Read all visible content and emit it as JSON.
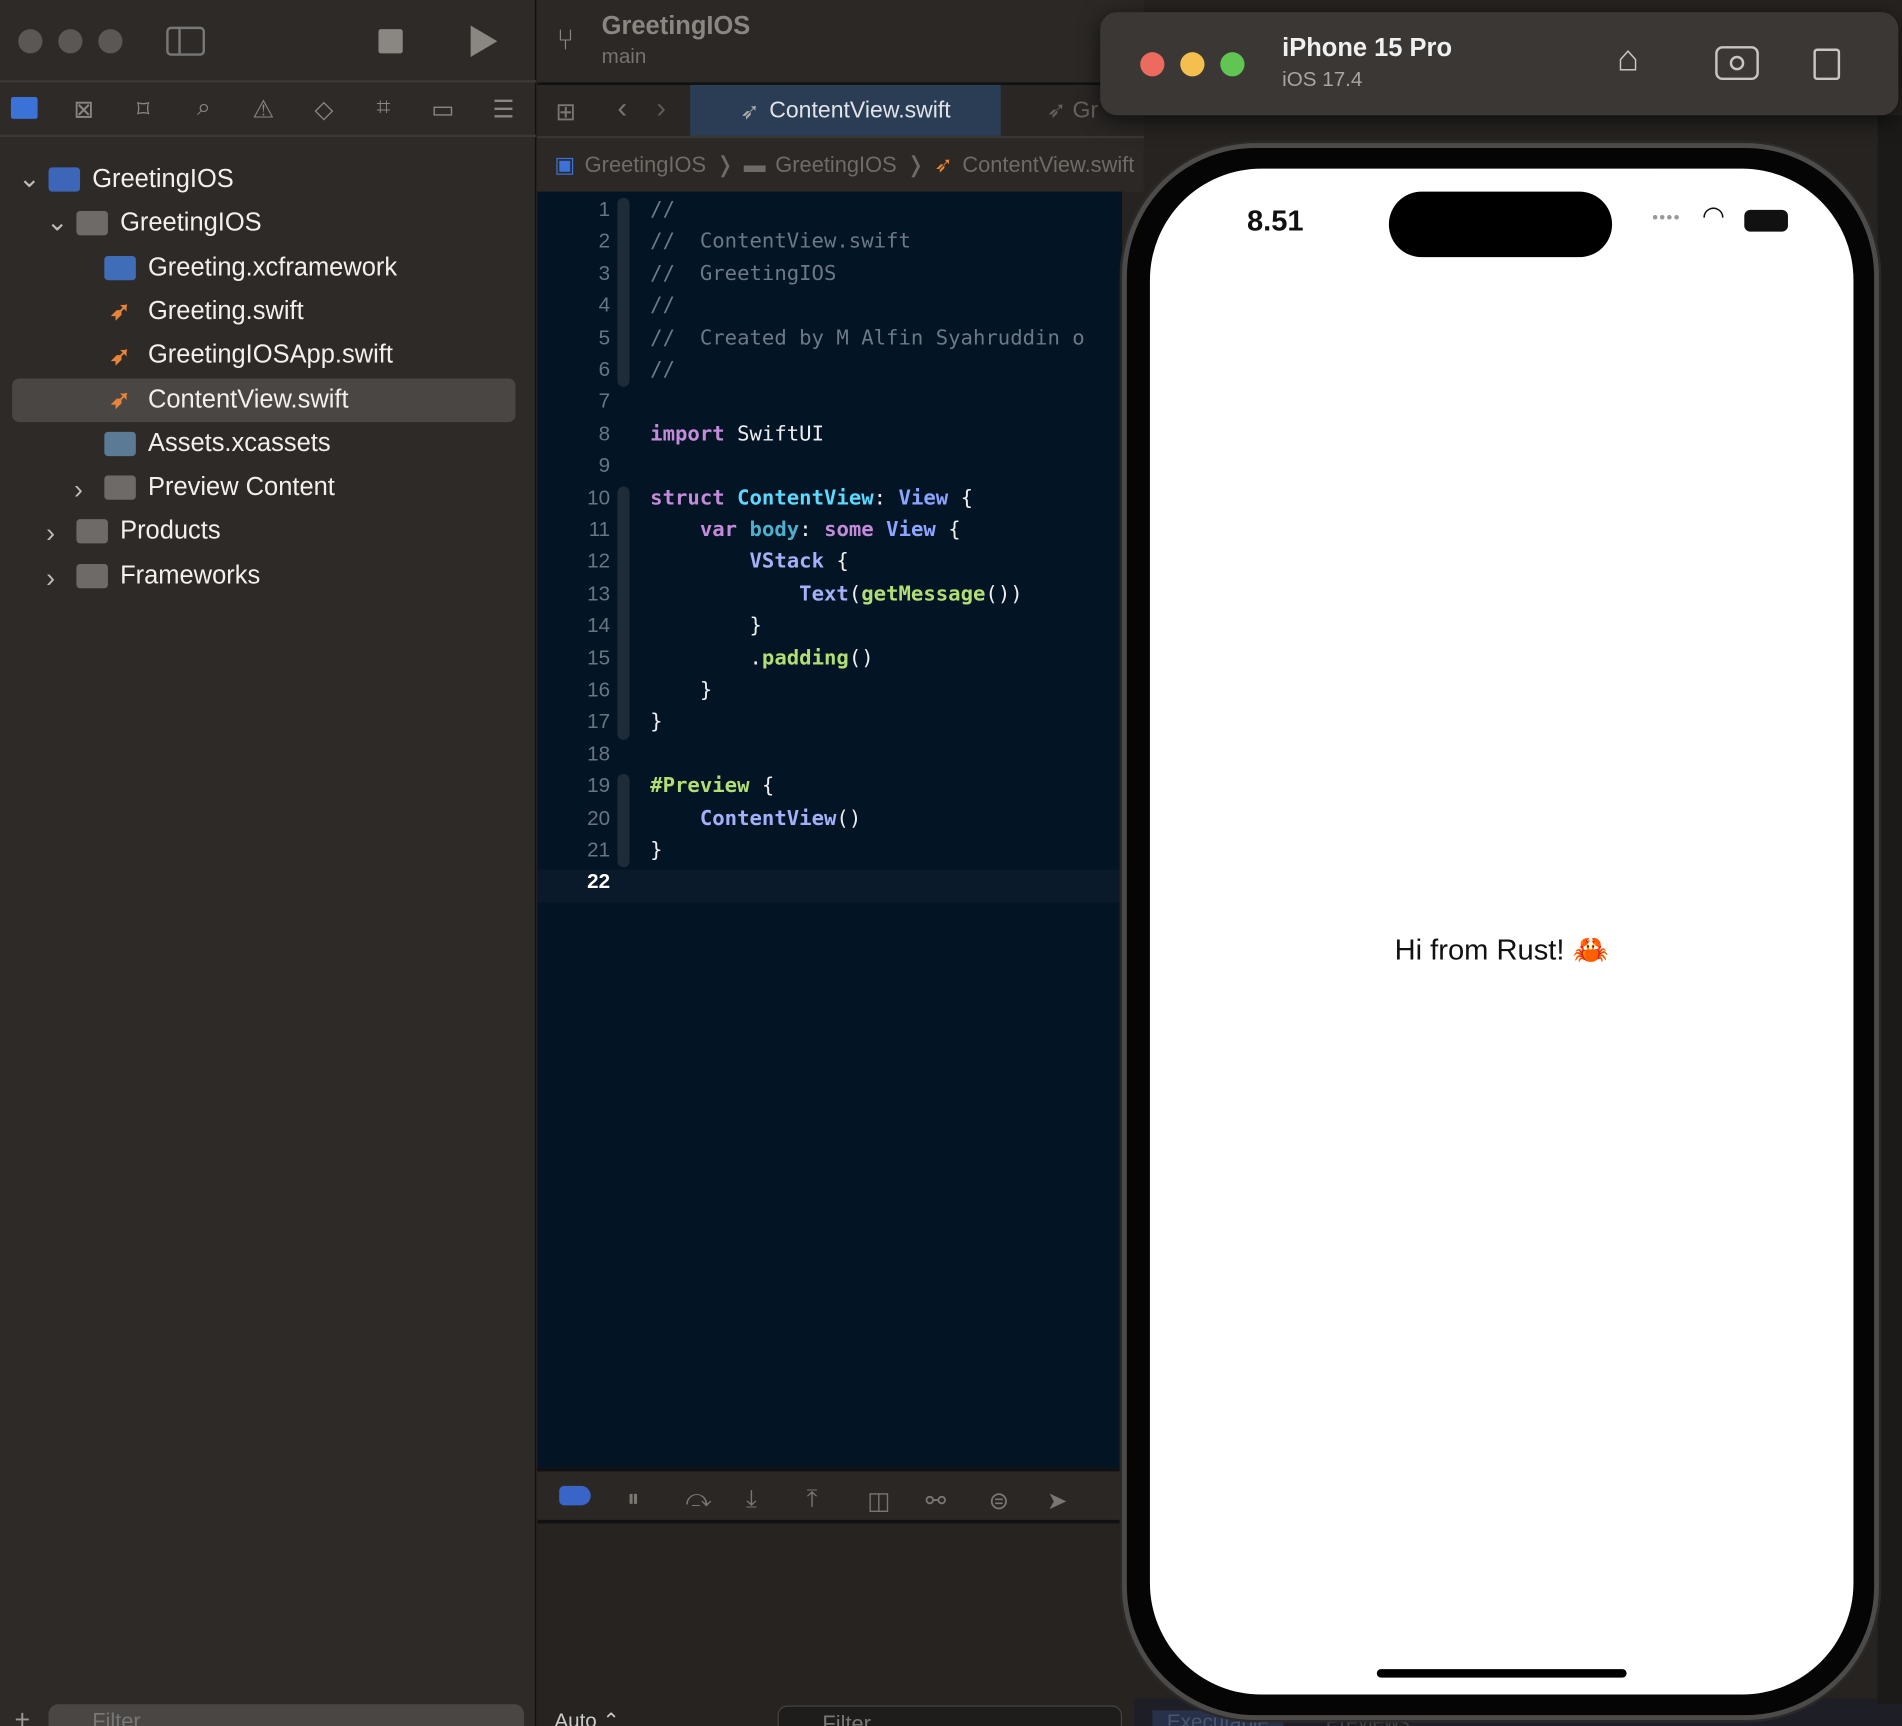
{
  "window": {
    "controls": [
      "close",
      "minimize",
      "zoom"
    ]
  },
  "toolbar": {
    "project": "GreetingIOS",
    "branch": "main",
    "stop_icon": "stop-icon",
    "run_icon": "play-icon"
  },
  "navigator_icons": [
    "folder-icon",
    "source-control-icon",
    "bookmark-icon",
    "search-icon",
    "warning-icon",
    "test-icon",
    "debug-icon",
    "breakpoint-icon",
    "report-icon"
  ],
  "tree": [
    {
      "label": "GreetingIOS",
      "type": "project",
      "level": 0,
      "expanded": true
    },
    {
      "label": "GreetingIOS",
      "type": "folder",
      "level": 1,
      "expanded": true
    },
    {
      "label": "Greeting.xcframework",
      "type": "framework",
      "level": 2
    },
    {
      "label": "Greeting.swift",
      "type": "swift",
      "level": 2
    },
    {
      "label": "GreetingIOSApp.swift",
      "type": "swift",
      "level": 2
    },
    {
      "label": "ContentView.swift",
      "type": "swift",
      "level": 2,
      "selected": true
    },
    {
      "label": "Assets.xcassets",
      "type": "assets",
      "level": 2
    },
    {
      "label": "Preview Content",
      "type": "folder",
      "level": 2,
      "expanded": false
    },
    {
      "label": "Products",
      "type": "folder",
      "level": 1,
      "expanded": false
    },
    {
      "label": "Frameworks",
      "type": "folder",
      "level": 1,
      "expanded": false
    }
  ],
  "tabs": [
    {
      "label": "ContentView.swift",
      "active": true
    },
    {
      "label": "Gr",
      "active": false
    }
  ],
  "breadcrumb": [
    "GreetingIOS",
    "GreetingIOS",
    "ContentView.swift"
  ],
  "code": {
    "current_line": 22,
    "lines": [
      [
        [
          "c",
          "//"
        ]
      ],
      [
        [
          "c",
          "//  ContentView.swift"
        ]
      ],
      [
        [
          "c",
          "//  GreetingIOS"
        ]
      ],
      [
        [
          "c",
          "//"
        ]
      ],
      [
        [
          "c",
          "//  Created by M Alfin Syahruddin o"
        ]
      ],
      [
        [
          "c",
          "//"
        ]
      ],
      [],
      [
        [
          "k",
          "import"
        ],
        [
          "p",
          " SwiftUI"
        ]
      ],
      [],
      [
        [
          "k",
          "struct"
        ],
        [
          "p",
          " "
        ],
        [
          "d",
          "ContentView"
        ],
        [
          "p",
          ": "
        ],
        [
          "t",
          "View"
        ],
        [
          "p",
          " {"
        ]
      ],
      [
        [
          "p",
          "    "
        ],
        [
          "k",
          "var"
        ],
        [
          "p",
          " "
        ],
        [
          "v",
          "body"
        ],
        [
          "p",
          ": "
        ],
        [
          "k",
          "some"
        ],
        [
          "p",
          " "
        ],
        [
          "t",
          "View"
        ],
        [
          "p",
          " {"
        ]
      ],
      [
        [
          "p",
          "        "
        ],
        [
          "f",
          "VStack"
        ],
        [
          "p",
          " {"
        ]
      ],
      [
        [
          "p",
          "            "
        ],
        [
          "f",
          "Text"
        ],
        [
          "p",
          "("
        ],
        [
          "g",
          "getMessage"
        ],
        [
          "p",
          "())"
        ]
      ],
      [
        [
          "p",
          "        }"
        ]
      ],
      [
        [
          "p",
          "        ."
        ],
        [
          "g",
          "padding"
        ],
        [
          "p",
          "()"
        ]
      ],
      [
        [
          "p",
          "    }"
        ]
      ],
      [
        [
          "p",
          "}"
        ]
      ],
      [],
      [
        [
          "g",
          "#Preview"
        ],
        [
          "p",
          " {"
        ]
      ],
      [
        [
          "p",
          "    "
        ],
        [
          "f",
          "ContentView"
        ],
        [
          "p",
          "()"
        ]
      ],
      [
        [
          "p",
          "}"
        ]
      ],
      []
    ]
  },
  "colors": {
    "c": "#6c7986",
    "k": "#c38bd9",
    "p": "#eceef0",
    "d": "#5dd8ff",
    "t": "#8ea5ff",
    "v": "#4eb0cc",
    "f": "#a3b1f9",
    "g": "#b2de76"
  },
  "bottom": {
    "filter_placeholder": "Filter",
    "auto_label": "Auto ⌃",
    "console_filter": "Filter",
    "console_tabs": [
      "Executable",
      "Previews"
    ]
  },
  "simulator": {
    "device": "iPhone 15 Pro",
    "os": "iOS 17.4",
    "time": "8.51",
    "message": "Hi from Rust! 🦀"
  }
}
